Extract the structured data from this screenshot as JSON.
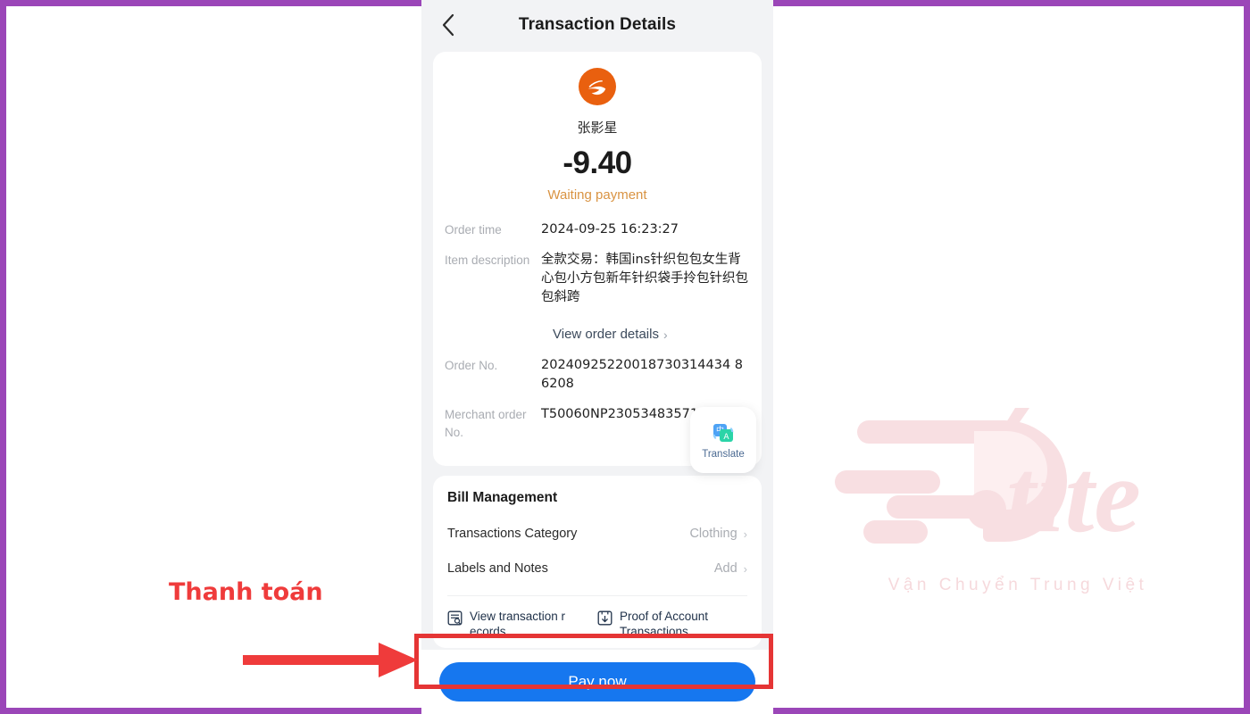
{
  "frame": {
    "border_color": "#9b46b8"
  },
  "watermark": {
    "logo_text": "tite",
    "subtitle": "Vận Chuyển Trung Việt",
    "color": "#f7dcdf"
  },
  "phone": {
    "topbar": {
      "back_icon": "chevron-left-icon",
      "title": "Transaction Details"
    },
    "summary": {
      "brand_icon": "alipay-logo-icon",
      "payee_name": "张影星",
      "amount": "-9.40",
      "status": "Waiting payment",
      "status_color": "#d99342"
    },
    "details": [
      {
        "label": "Order time",
        "value": "2024-09-25 16:23:27"
      },
      {
        "label": "Item description",
        "value": "全款交易：韩国ins针织包包女生背心包小方包新年针织袋手拎包针织包包斜跨"
      },
      {
        "label": "Order No.",
        "value": "20240925220018730314434 86208"
      },
      {
        "label": "Merchant order No.",
        "value": "T50060NP23053483571052"
      }
    ],
    "order_link": {
      "text": "View order details",
      "chevron": "›"
    },
    "translate_fab": {
      "label": "Translate",
      "icon": "translate-icon",
      "glyph_cn": "中",
      "glyph_en": "A"
    },
    "bill": {
      "title": "Bill Management",
      "rows": [
        {
          "label": "Transactions Category",
          "value": "Clothing",
          "chevron": "›"
        },
        {
          "label": "Labels and Notes",
          "value": "Add",
          "chevron": "›"
        }
      ],
      "actions": [
        {
          "icon": "view-transaction-records-icon",
          "label": "View transaction r ecords"
        },
        {
          "icon": "proof-of-account-transactions-icon",
          "label": "Proof of Account Transactions"
        }
      ]
    },
    "pay_button": {
      "label": "Pay now",
      "color": "#1677ef"
    }
  },
  "annotations": {
    "callout_text": "Thanh toán",
    "callout_color": "#ef3b3b",
    "highlight_color": "#e53535"
  }
}
